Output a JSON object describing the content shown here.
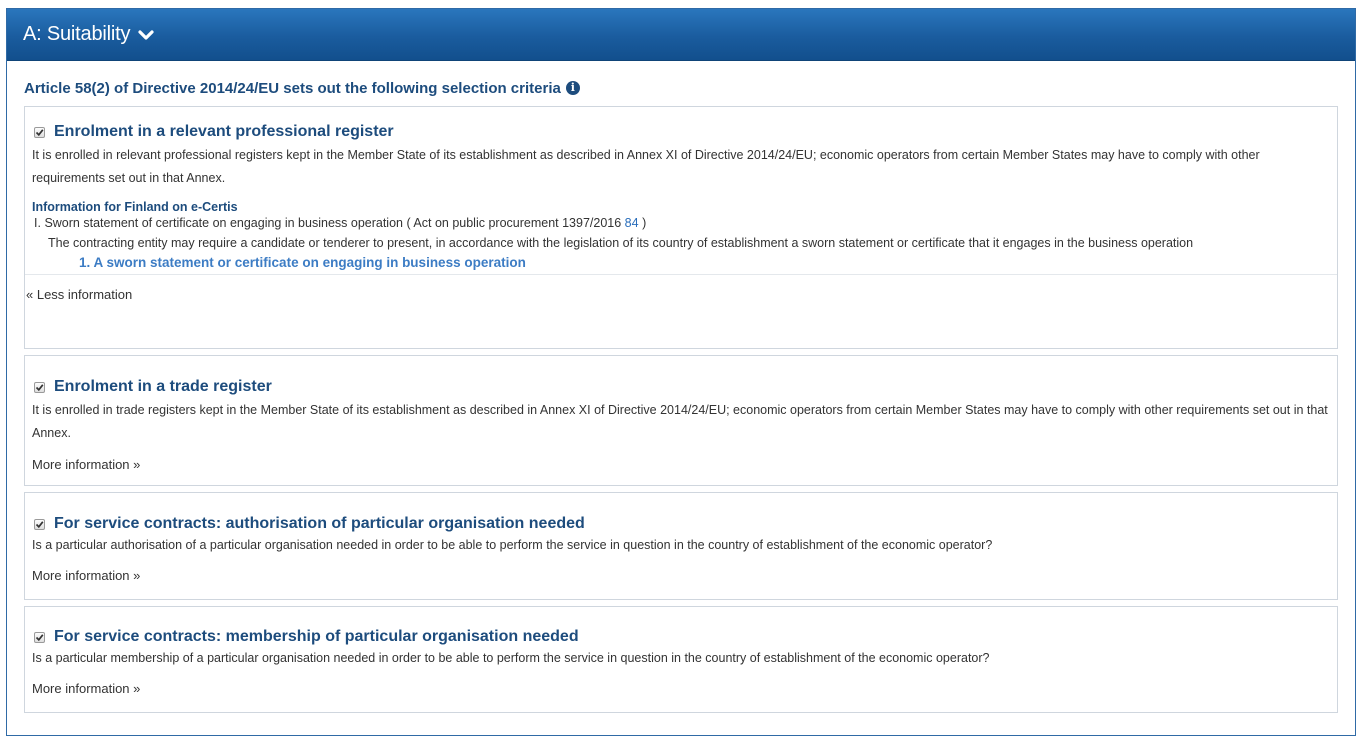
{
  "header": {
    "title": "A: Suitability"
  },
  "intro": {
    "text": "Article 58(2) of Directive 2014/24/EU sets out the following selection criteria"
  },
  "cards": [
    {
      "title": "Enrolment in a relevant professional register",
      "checked": true,
      "description": "It is enrolled in relevant professional registers kept in the Member State of its establishment as described in Annex XI of Directive 2014/24/EU; economic operators from certain Member States may have to comply with other requirements set out in that Annex.",
      "ecertis": {
        "title": "Information for Finland on e-Certis",
        "item_prefix": "I.",
        "item_text": "Sworn statement of certificate on engaging in business operation ( Act on public procurement 1397/2016",
        "item_ref": "84",
        "item_close": ")",
        "item_description": "The contracting entity may require a candidate or tenderer to present, in accordance with the legislation of its country of establishment a sworn statement or certificate that it engages in the business operation",
        "sub_item_prefix": "1.",
        "sub_item_text": "A sworn statement or certificate on engaging in business operation"
      },
      "toggle_label": "« Less information"
    },
    {
      "title": "Enrolment in a trade register",
      "checked": true,
      "description": "It is enrolled in trade registers kept in the Member State of its establishment as described in Annex XI of Directive 2014/24/EU; economic operators from certain Member States may have to comply with other requirements set out in that Annex.",
      "toggle_label": "More information »"
    },
    {
      "title": "For service contracts: authorisation of particular organisation needed",
      "checked": true,
      "description": "Is a particular authorisation of a particular organisation needed in order to be able to perform the service in question in the country of establishment of the economic operator?",
      "toggle_label": "More information »"
    },
    {
      "title": "For service contracts: membership of particular organisation needed",
      "checked": true,
      "description": "Is a particular membership of a particular organisation needed in order to be able to perform the service in question in the country of establishment of the economic operator?",
      "toggle_label": "More information »"
    }
  ],
  "colors": {
    "header": "#1a5c9e",
    "title": "#1d4c7d",
    "link": "#3c7cc4"
  },
  "icons": {
    "header_toggle": "chevron-down-icon",
    "info": "info-icon",
    "checkbox": "checkbox-checked-icon"
  }
}
